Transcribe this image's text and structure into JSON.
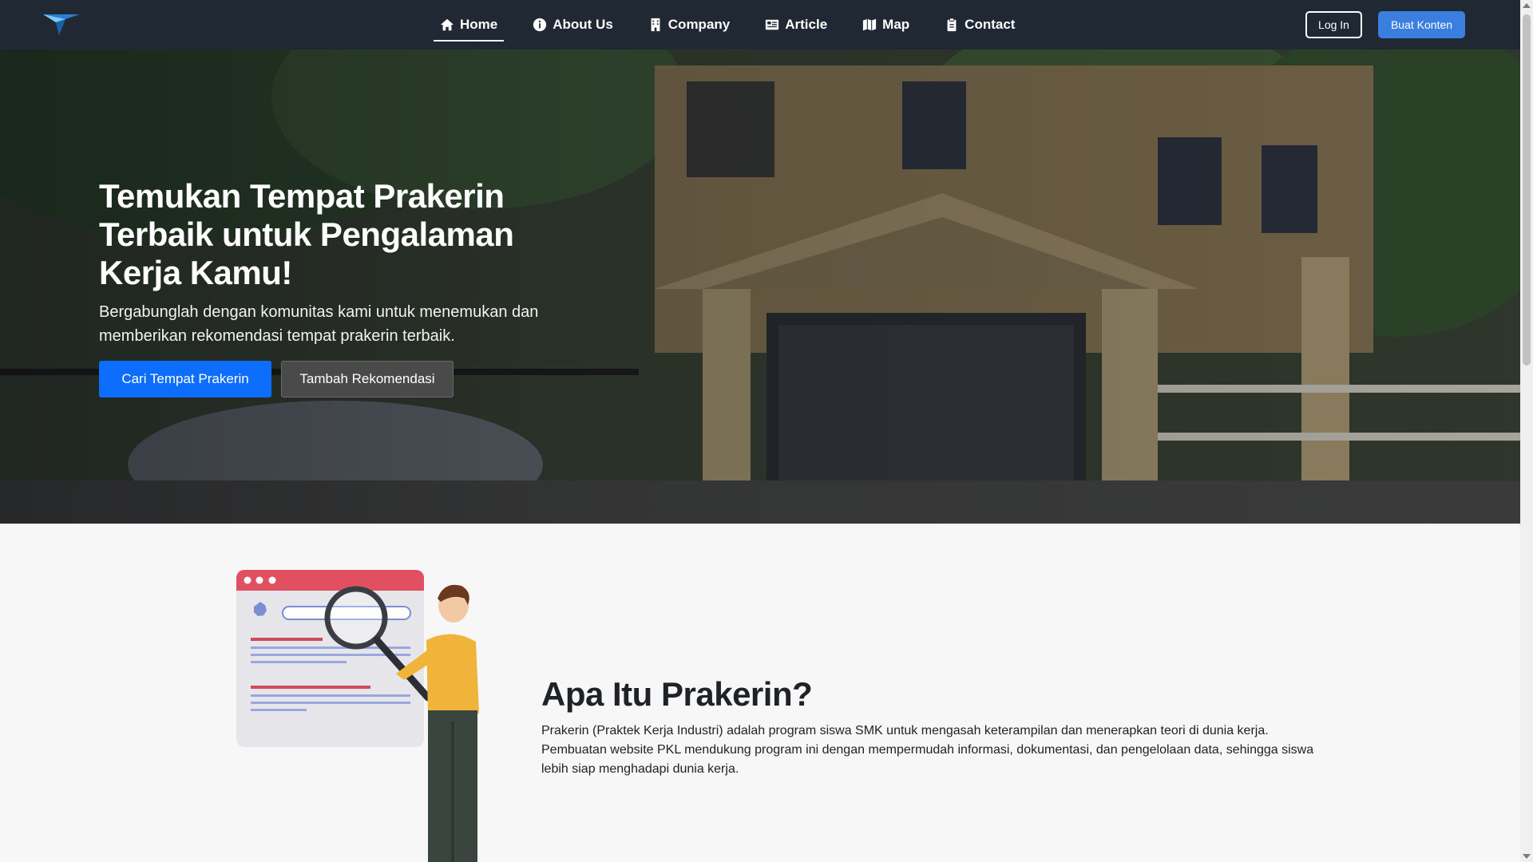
{
  "nav": {
    "items": [
      {
        "label": "Home",
        "icon": "home-icon",
        "active": true
      },
      {
        "label": "About Us",
        "icon": "info-icon",
        "active": false
      },
      {
        "label": "Company",
        "icon": "building-icon",
        "active": false
      },
      {
        "label": "Article",
        "icon": "newspaper-icon",
        "active": false
      },
      {
        "label": "Map",
        "icon": "map-icon",
        "active": false
      },
      {
        "label": "Contact",
        "icon": "clipboard-icon",
        "active": false
      }
    ],
    "login_label": "Log In",
    "create_label": "Buat Konten"
  },
  "hero": {
    "title": "Temukan Tempat Prakerin Terbaik untuk Pengalaman Kerja Kamu!",
    "subtitle": "Bergabunglah dengan komunitas kami untuk menemukan dan memberikan rekomendasi tempat prakerin terbaik.",
    "primary_button": "Cari Tempat Prakerin",
    "secondary_button": "Tambah Rekomendasi"
  },
  "about": {
    "title": "Apa Itu Prakerin?",
    "description": "Prakerin (Praktek Kerja Industri) adalah program siswa SMK untuk mengasah keterampilan dan menerapkan teori di dunia kerja. Pembuatan website PKL mendukung program ini dengan mempermudah informasi, dokumentasi, dan pengelolaan data, sehingga siswa lebih siap menghadapi dunia kerja."
  },
  "colors": {
    "navbar_bg": "#1f2833",
    "primary": "#0d6efd",
    "create_button": "#3a7ee0"
  }
}
